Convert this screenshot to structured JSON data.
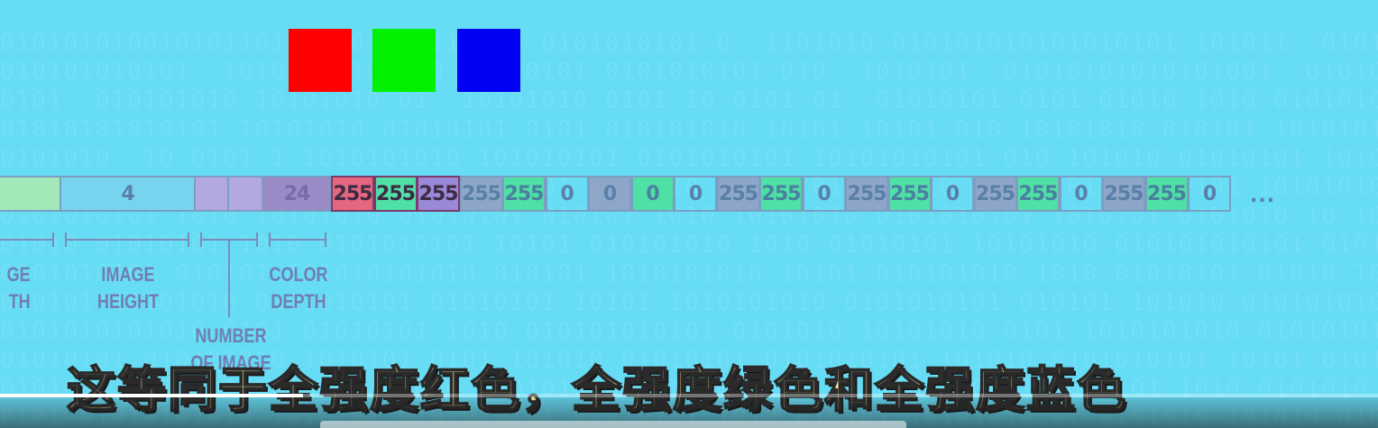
{
  "colors": {
    "red": "#ff0000",
    "green": "#00f000",
    "blue": "#0000f5",
    "pixel_red": "#e4667f",
    "pixel_green": "#4fe0a6",
    "pixel_blue_block": "#9a88d8",
    "neutral": "#8ea6c8",
    "image_width_cell": "#a3e8b8",
    "number_cell": "#b3a8e0",
    "depth_cell": "#9a8ac6"
  },
  "strip": {
    "header_height_value": "4",
    "color_depth_value": "24",
    "pixel_values": [
      "255",
      "255",
      "255",
      "255",
      "255",
      "0",
      "0",
      "0",
      "0",
      "255",
      "255",
      "0",
      "255",
      "255",
      "0",
      "255",
      "255",
      "0",
      "255",
      "255",
      "0"
    ],
    "ellipsis": "..."
  },
  "labels": {
    "image_width": "GE\nTH",
    "image_height": "IMAGE\nHEIGHT",
    "color_depth": "COLOR\nDEPTH",
    "number_of_images": "NUMBER\nOF IMAGE"
  },
  "subtitle": "这等同于全强度红色，全强度绿色和全强度蓝色",
  "video": {
    "progress_percent": 22
  }
}
